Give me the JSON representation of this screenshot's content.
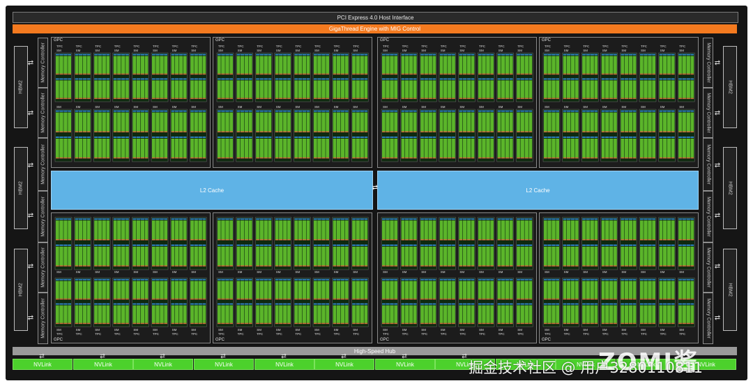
{
  "pcie_label": "PCI Express 4.0 Host Interface",
  "gigathread_label": "GigaThread Engine with MIG Control",
  "hub_label": "High-Speed Hub",
  "hbm_label": "HBM2",
  "memory_controller_label": "Memory Controller",
  "l2_label": "L2 Cache",
  "gpc_label": "GPC",
  "tpc_label": "TPC",
  "sm_label": "SM",
  "nvlink_label": "NVLink",
  "arrow_glyph": "⇄",
  "watermark": {
    "logo": "ZOMI",
    "logo_extra": "酱",
    "text": "掘金技术社区 @ 用户3280110811"
  },
  "colors": {
    "background": "#151515",
    "pcie": "#2a2a2a",
    "gigathread": "#f47a1f",
    "l2_cache": "#5fb3e6",
    "hub": "#9a9a9a",
    "nvlink": "#4cd12c",
    "sm_core": "#5bb52a",
    "sm_tensor": "#2f7fbf"
  }
}
